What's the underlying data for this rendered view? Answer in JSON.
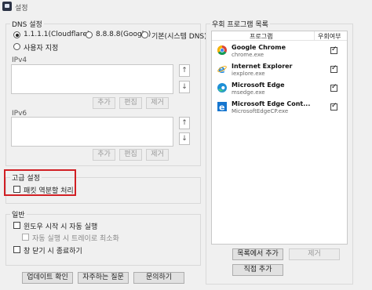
{
  "window": {
    "title": "설정"
  },
  "dns": {
    "legend": "DNS 설정",
    "options": [
      "1.1.1.1(Cloudflare)",
      "8.8.8.8(Google)",
      "기본(시스템 DNS)"
    ],
    "custom_label": "사용자 지정",
    "ipv4_label": "IPv4",
    "ipv6_label": "IPv6",
    "up_glyph": "↑",
    "down_glyph": "↓",
    "add_label": "추가",
    "edit_label": "편집",
    "remove_label": "제거"
  },
  "advanced": {
    "legend": "고급 설정",
    "packet_fragment_label": "패킷 역분할 처리"
  },
  "general": {
    "legend": "일반",
    "autostart_label": "윈도우 시작 시 자동 실행",
    "minimize_tray_label": "자동 실행 시 트레이로 최소화",
    "close_exit_label": "창 닫기 시 종료하기"
  },
  "footer": {
    "update_label": "업데이트 확인",
    "faq_label": "자주하는 질문",
    "contact_label": "문의하기"
  },
  "bypass": {
    "legend": "우회 프로그램 목록",
    "col_program": "프로그램",
    "col_bypass": "우회여부",
    "programs": [
      {
        "name": "Google Chrome",
        "exe": "chrome.exe",
        "checked": true,
        "icon": "chrome-icon"
      },
      {
        "name": "Internet Explorer",
        "exe": "iexplore.exe",
        "checked": true,
        "icon": "internet-explorer-icon"
      },
      {
        "name": "Microsoft Edge",
        "exe": "msedge.exe",
        "checked": true,
        "icon": "edge-icon"
      },
      {
        "name": "Microsoft Edge Cont...",
        "exe": "MicrosoftEdgeCP.exe",
        "checked": true,
        "icon": "edge-legacy-icon"
      }
    ],
    "add_from_list_label": "목록에서 추가",
    "remove_label": "제거",
    "add_direct_label": "직접 추가"
  }
}
